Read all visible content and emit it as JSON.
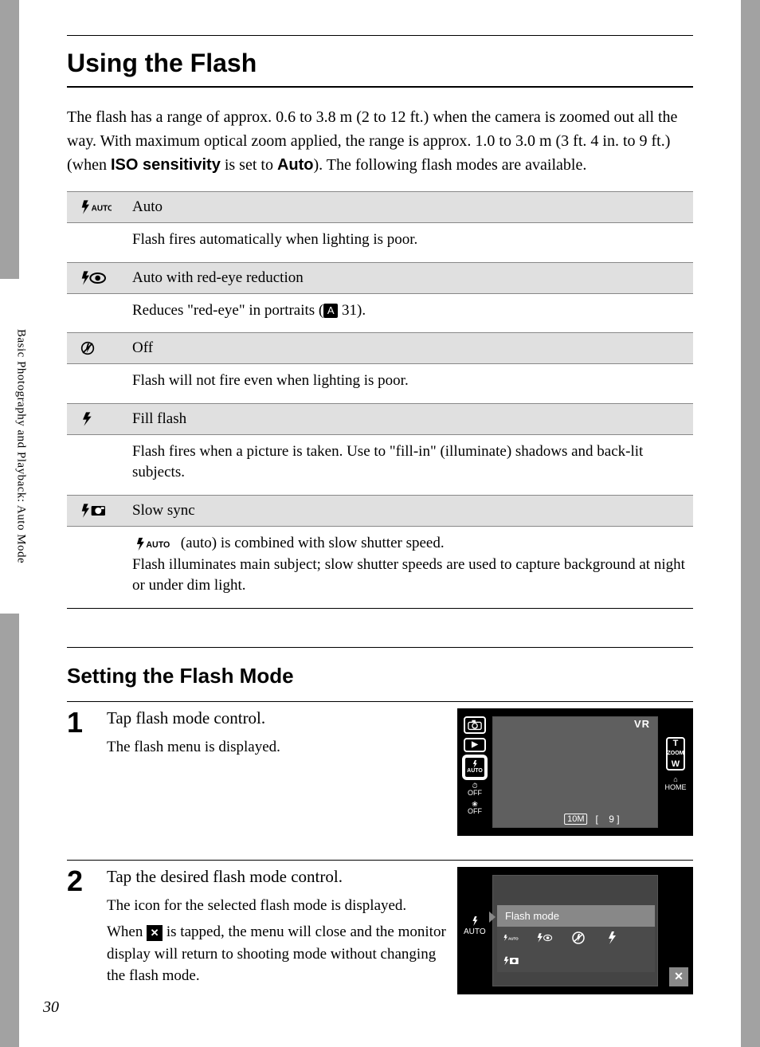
{
  "sidebar_tab": "Basic Photography and Playback: Auto Mode",
  "page_number": "30",
  "title": "Using the Flash",
  "intro": {
    "part1": "The flash has a range of approx. 0.6 to 3.8 m (2 to 12 ft.) when the camera is zoomed out all the way. With maximum optical zoom applied, the range is approx. 1.0 to 3.0 m (3 ft. 4 in. to 9 ft.) (when ",
    "bold1": "ISO sensitivity",
    "mid": " is set to ",
    "bold2": "Auto",
    "part2": "). The following flash modes are available."
  },
  "modes": [
    {
      "icon": "flash-auto-icon",
      "name": "Auto",
      "desc": "Flash fires automatically when lighting is poor."
    },
    {
      "icon": "flash-redeye-icon",
      "name": "Auto with red-eye reduction",
      "desc_pre": "Reduces \"red-eye\" in portraits (",
      "desc_ref": "31",
      "desc_post": ")."
    },
    {
      "icon": "flash-off-icon",
      "name": "Off",
      "desc": "Flash will not fire even when lighting is poor."
    },
    {
      "icon": "flash-fill-icon",
      "name": "Fill flash",
      "desc": "Flash fires when a picture is taken. Use to \"fill-in\" (illuminate) shadows and back-lit subjects."
    },
    {
      "icon": "flash-slow-icon",
      "name": "Slow sync",
      "desc_inline_icon": "flash-auto-icon",
      "desc_pre": " (auto) is combined with slow shutter speed.",
      "desc_line2": "Flash illuminates main subject; slow shutter speeds are used to capture background at night or under dim light."
    }
  ],
  "section2_title": "Setting the Flash Mode",
  "steps": [
    {
      "num": "1",
      "title": "Tap flash mode control.",
      "text1": "The flash menu is displayed."
    },
    {
      "num": "2",
      "title": "Tap the desired flash mode control.",
      "text1": "The icon for the selected flash mode is displayed.",
      "text2_pre": "When ",
      "text2_post": " is tapped, the menu will close and the monitor display will return to shooting mode without changing the flash mode."
    }
  ],
  "illus1": {
    "vr": "VR",
    "zoom_top": "T",
    "zoom_label": "ZOOM",
    "zoom_bottom": "W",
    "home": "HOME",
    "bottom_10m": "10M",
    "bottom_9": "9",
    "left_auto": "AUTO",
    "left_off1": "OFF",
    "left_off2": "OFF"
  },
  "illus2": {
    "menu_title": "Flash mode",
    "side_auto": "AUTO",
    "opt1": "AUTO",
    "close": "✕"
  }
}
